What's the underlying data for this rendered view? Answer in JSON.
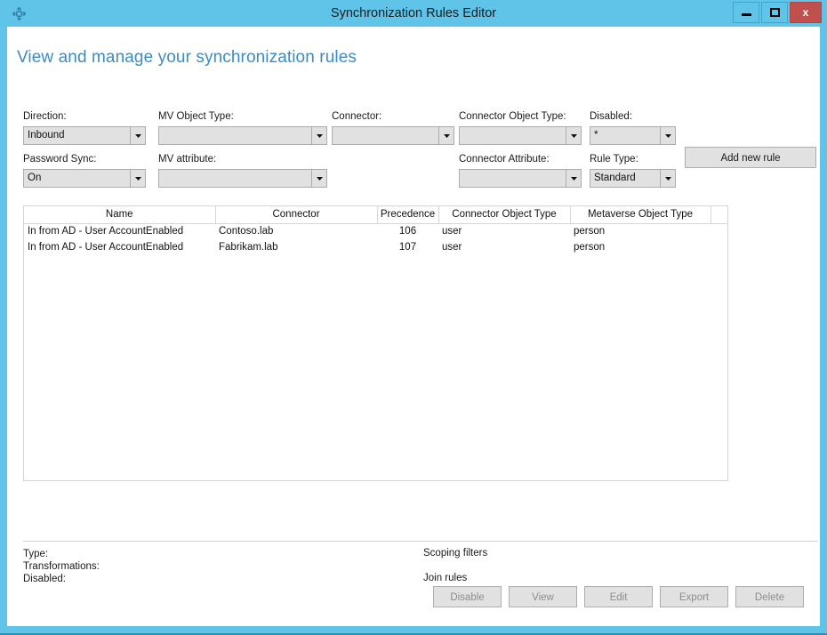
{
  "window": {
    "title": "Synchronization Rules Editor",
    "icon": "sync-diamond-icon",
    "accent_color": "#5FC4E8",
    "close_color": "#C0504D",
    "controls": {
      "minimize_label": "–",
      "maximize_label": "□",
      "close_label": "x"
    }
  },
  "page": {
    "heading": "View and manage your synchronization rules",
    "heading_color": "#3E8BC4"
  },
  "filters": {
    "row1": [
      {
        "label": "Direction:",
        "value": "Inbound"
      },
      {
        "label": "MV Object Type:",
        "value": ""
      },
      {
        "label": "Connector:",
        "value": ""
      },
      {
        "label": "Connector Object Type:",
        "value": ""
      },
      {
        "label": "Disabled:",
        "value": "*"
      }
    ],
    "row2": [
      {
        "label": "Password Sync:",
        "value": "On"
      },
      {
        "label": "MV attribute:",
        "value": ""
      },
      {
        "label": "Connector Attribute:",
        "value": ""
      },
      {
        "label": "Rule Type:",
        "value": "Standard"
      }
    ]
  },
  "toolbar": {
    "add_new_rule_label": "Add new rule"
  },
  "grid": {
    "columns": [
      "Name",
      "Connector",
      "Precedence",
      "Connector Object Type",
      "Metaverse Object Type"
    ],
    "rows": [
      {
        "name": "In from AD - User AccountEnabled",
        "connector": "Contoso.lab",
        "precedence": "106",
        "connector_object_type": "user",
        "metaverse_object_type": "person"
      },
      {
        "name": "In from AD - User AccountEnabled",
        "connector": "Fabrikam.lab",
        "precedence": "107",
        "connector_object_type": "user",
        "metaverse_object_type": "person"
      }
    ]
  },
  "details": {
    "type_label": "Type:",
    "transformations_label": "Transformations:",
    "disabled_label": "Disabled:",
    "scoping_filters_label": "Scoping filters",
    "join_rules_label": "Join rules"
  },
  "actions": [
    {
      "label": "Disable",
      "enabled": false
    },
    {
      "label": "View",
      "enabled": false
    },
    {
      "label": "Edit",
      "enabled": false
    },
    {
      "label": "Export",
      "enabled": false
    },
    {
      "label": "Delete",
      "enabled": false
    }
  ]
}
